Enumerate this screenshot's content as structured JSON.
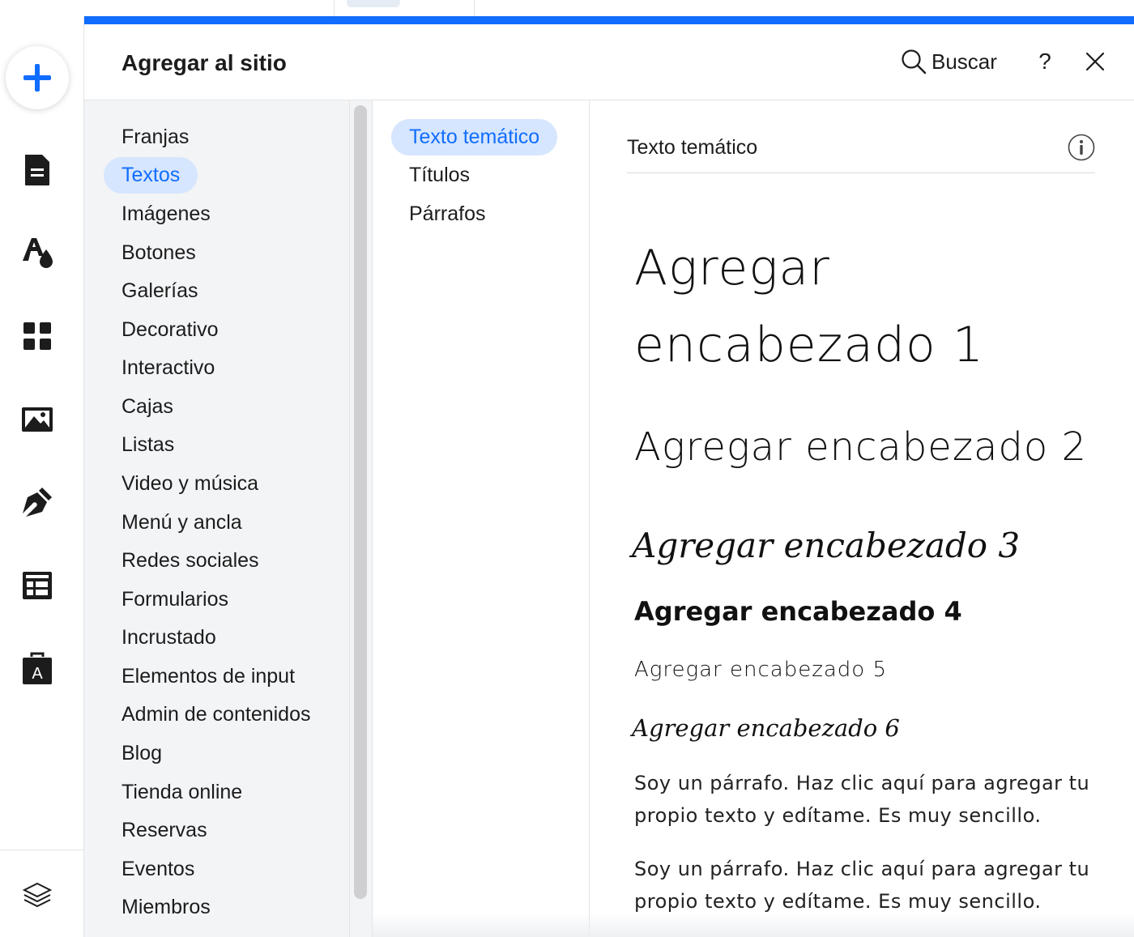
{
  "panel": {
    "title": "Agregar al sitio",
    "search_label": "Buscar",
    "help_label": "?"
  },
  "rail": {
    "icons": [
      "add-icon",
      "page-icon",
      "theme-icon",
      "apps-icon",
      "media-icon",
      "pen-icon",
      "table-icon",
      "business-icon",
      "layers-icon"
    ]
  },
  "categories": [
    "Franjas",
    "Textos",
    "Imágenes",
    "Botones",
    "Galerías",
    "Decorativo",
    "Interactivo",
    "Cajas",
    "Listas",
    "Video y música",
    "Menú y ancla",
    "Redes sociales",
    "Formularios",
    "Incrustado",
    "Elementos de input",
    "Admin de contenidos",
    "Blog",
    "Tienda online",
    "Reservas",
    "Eventos",
    "Miembros"
  ],
  "active_category": "Textos",
  "subcategories": [
    "Texto temático",
    "Títulos",
    "Párrafos"
  ],
  "active_subcategory": "Texto temático",
  "preview": {
    "section_title": "Texto temático",
    "h1": "Agregar encabezado 1",
    "h2": "Agregar encabezado 2",
    "h3": "Agregar encabezado 3",
    "h4": "Agregar encabezado 4",
    "h5": "Agregar encabezado 5",
    "h6": "Agregar encabezado 6",
    "paragraph1": "Soy un párrafo. Haz clic aquí para agregar tu propio texto y edítame. Es muy sencillo.",
    "paragraph2": "Soy un párrafo. Haz clic aquí para agregar tu propio texto y edítame. Es muy sencillo."
  },
  "colors": {
    "accent": "#116dff",
    "active_bg": "#d6e6fe",
    "sidebar_bg": "#f3f4f6"
  }
}
